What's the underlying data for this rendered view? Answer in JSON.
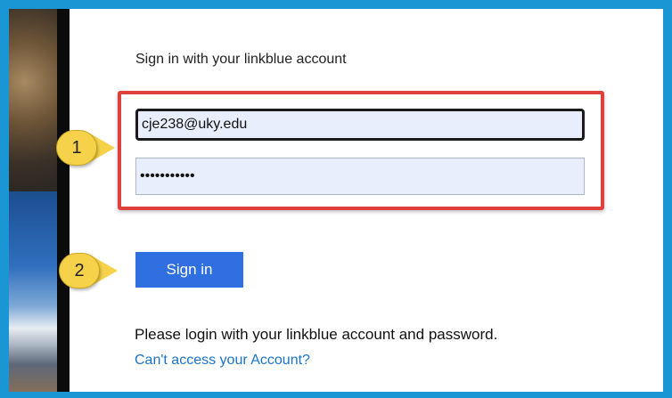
{
  "form": {
    "heading": "Sign in with your linkblue account",
    "username_value": "cje238@uky.edu",
    "password_value": "•••••••••••",
    "sign_in_label": "Sign in",
    "help_text": "Please login with your linkblue account and password.",
    "help_link": "Can't access your Account?"
  },
  "callouts": {
    "step1": "1",
    "step2": "2"
  },
  "colors": {
    "frame": "#1a96d4",
    "highlight_border": "#e0403c",
    "callout_fill": "#f6d24a",
    "button_bg": "#2f6fe0",
    "link": "#1a73c8"
  }
}
